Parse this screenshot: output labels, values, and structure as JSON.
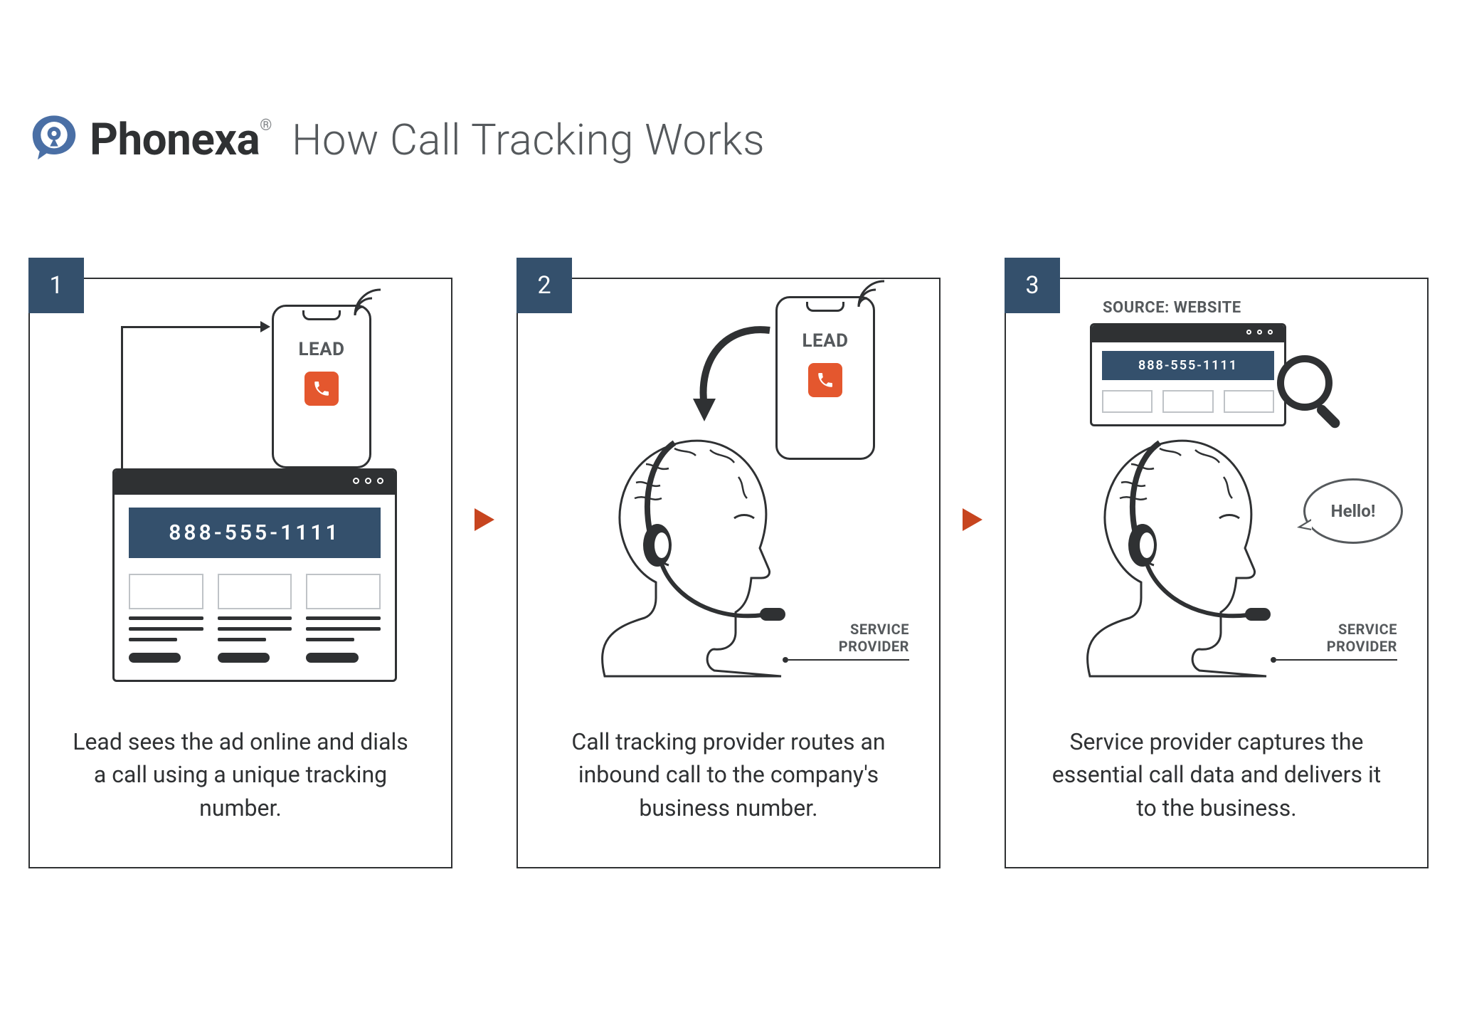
{
  "brand": "Phonexa",
  "brand_reg": "®",
  "tagline": "How Call Tracking Works",
  "tracking_number": "888-555-1111",
  "lead_label": "LEAD",
  "service_provider_label1": "SERVICE",
  "service_provider_label2": "PROVIDER",
  "bubble_text": "Hello!",
  "source_label": "SOURCE:  WEBSITE",
  "steps": [
    {
      "n": "1",
      "caption": "Lead sees the ad online and dials a call using a unique tracking number."
    },
    {
      "n": "2",
      "caption": "Call tracking provider routes an inbound call to the company's business number."
    },
    {
      "n": "3",
      "caption": "Service provider captures the essential call data and delivers it to the business."
    }
  ]
}
